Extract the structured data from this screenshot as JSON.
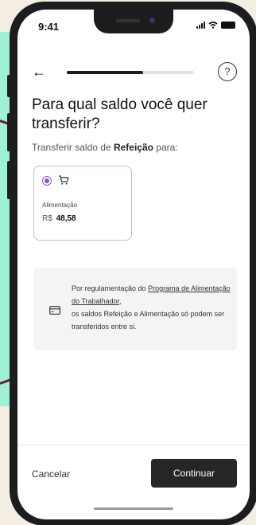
{
  "status": {
    "time": "9:41"
  },
  "nav": {
    "back_icon": "←",
    "help_icon": "?",
    "progress": 0.6
  },
  "header": {
    "title": "Para qual saldo você quer transferir?"
  },
  "subtitle": {
    "prefix": "Transferir saldo de ",
    "source": "Refeição",
    "suffix": " para:"
  },
  "option": {
    "label": "Alimentação",
    "currency": "R$",
    "amount": "48,58",
    "selected": true
  },
  "info": {
    "line_1": "Por regulamentação do ",
    "link_1": "Programa de Alimentação do Trabalhador",
    "line_2": ",",
    "line_3": "os saldos Refeição e Alimentação só podem ser transferidos entre si."
  },
  "footer": {
    "cancel_label": "Cancelar",
    "continue_label": "Continuar"
  },
  "colors": {
    "accent": "#8a5ac4",
    "card_border": "#c9b7df",
    "button_bg": "#262626",
    "bg_shape": "#9ff0d6"
  }
}
